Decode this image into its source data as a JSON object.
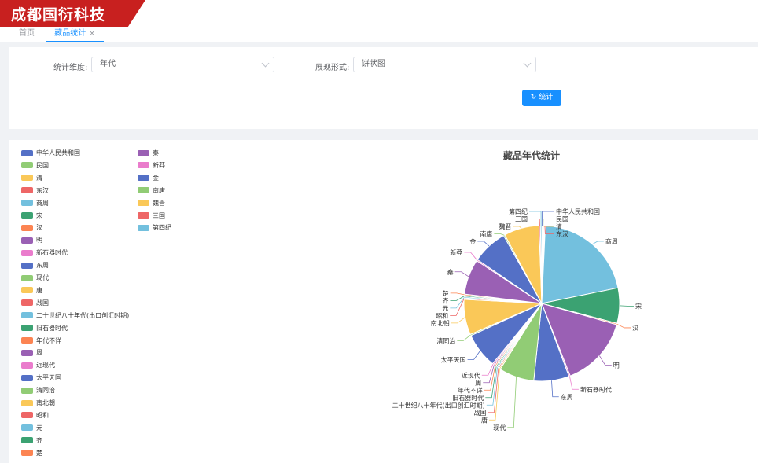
{
  "app": {
    "brand": "成都国衍科技"
  },
  "tabs": {
    "home": "首页",
    "active": "藏品统计",
    "close_glyph": "×"
  },
  "form": {
    "dimension_label": "统计维度:",
    "dimension_value": "年代",
    "display_label": "展现形式:",
    "display_value": "饼状图",
    "stat_button": "统计",
    "refresh_glyph": "↻"
  },
  "chart_data": {
    "type": "pie",
    "title": "藏品年代统计",
    "legend_position": "left",
    "slices": [
      {
        "name": "中华人民共和国",
        "value": 0.2,
        "color": "#5470c6"
      },
      {
        "name": "民国",
        "value": 0.2,
        "color": "#91cc75"
      },
      {
        "name": "清",
        "value": 0.2,
        "color": "#fac858"
      },
      {
        "name": "东汉",
        "value": 0.2,
        "color": "#ee6666"
      },
      {
        "name": "商周",
        "value": 23,
        "color": "#73c0de"
      },
      {
        "name": "宋",
        "value": 8,
        "color": "#3ba272"
      },
      {
        "name": "汉",
        "value": 0.3,
        "color": "#fc8452"
      },
      {
        "name": "明",
        "value": 16,
        "color": "#9a60b4"
      },
      {
        "name": "新石器时代",
        "value": 0.3,
        "color": "#ea7ccc"
      },
      {
        "name": "东周",
        "value": 8,
        "color": "#5470c6"
      },
      {
        "name": "现代",
        "value": 8,
        "color": "#91cc75"
      },
      {
        "name": "唐",
        "value": 0.3,
        "color": "#fac858"
      },
      {
        "name": "战国",
        "value": 0.3,
        "color": "#ee6666"
      },
      {
        "name": "二十世纪八十年代(出口创汇时期)",
        "value": 0.3,
        "color": "#73c0de"
      },
      {
        "name": "旧石器时代",
        "value": 0.3,
        "color": "#3ba272"
      },
      {
        "name": "年代不详",
        "value": 0.3,
        "color": "#fc8452"
      },
      {
        "name": "周",
        "value": 0.3,
        "color": "#9a60b4"
      },
      {
        "name": "近现代",
        "value": 0.3,
        "color": "#ea7ccc"
      },
      {
        "name": "太平天国",
        "value": 8,
        "color": "#5470c6"
      },
      {
        "name": "清同治",
        "value": 0.3,
        "color": "#91cc75"
      },
      {
        "name": "南北朝",
        "value": 8,
        "color": "#fac858"
      },
      {
        "name": "昭和",
        "value": 0.3,
        "color": "#ee6666"
      },
      {
        "name": "元",
        "value": 0.3,
        "color": "#73c0de"
      },
      {
        "name": "齐",
        "value": 0.3,
        "color": "#3ba272"
      },
      {
        "name": "楚",
        "value": 0.3,
        "color": "#fc8452"
      },
      {
        "name": "秦",
        "value": 8,
        "color": "#9a60b4"
      },
      {
        "name": "新莽",
        "value": 0.3,
        "color": "#ea7ccc"
      },
      {
        "name": "金",
        "value": 8,
        "color": "#5470c6"
      },
      {
        "name": "南唐",
        "value": 0.3,
        "color": "#91cc75"
      },
      {
        "name": "魏晋",
        "value": 8,
        "color": "#fac858"
      },
      {
        "name": "三国",
        "value": 0.3,
        "color": "#ee6666"
      },
      {
        "name": "第四纪",
        "value": 0.3,
        "color": "#73c0de"
      }
    ]
  }
}
